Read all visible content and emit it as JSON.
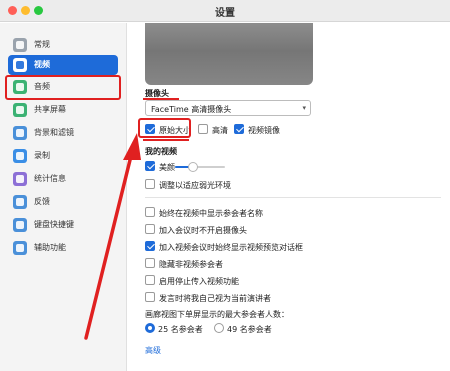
{
  "window": {
    "title": "设置"
  },
  "sidebar": {
    "items": [
      {
        "label": "常规",
        "icon": "gear-icon",
        "active": false
      },
      {
        "label": "视频",
        "icon": "video-camera-icon",
        "active": true
      },
      {
        "label": "音频",
        "icon": "headphones-icon",
        "active": false
      },
      {
        "label": "共享屏幕",
        "icon": "share-screen-icon",
        "active": false
      },
      {
        "label": "背景和滤镜",
        "icon": "background-filter-icon",
        "active": false
      },
      {
        "label": "录制",
        "icon": "record-icon",
        "active": false
      },
      {
        "label": "统计信息",
        "icon": "statistics-icon",
        "active": false
      },
      {
        "label": "反馈",
        "icon": "feedback-icon",
        "active": false
      },
      {
        "label": "键盘快捷键",
        "icon": "keyboard-icon",
        "active": false
      },
      {
        "label": "辅助功能",
        "icon": "accessibility-icon",
        "active": false
      }
    ]
  },
  "camera": {
    "section_label": "摄像头",
    "selected_camera": "FaceTime 高清摄像头",
    "options": [
      {
        "label": "原始大小",
        "checked": true
      },
      {
        "label": "高清",
        "checked": false
      },
      {
        "label": "视频镜像",
        "checked": true
      }
    ]
  },
  "my_video": {
    "section_label": "我的视频",
    "beautify_label": "美颜",
    "beautify_checked": true,
    "beautify_level": 0.35,
    "low_light_label": "调整以适应弱光环境",
    "low_light_checked": false
  },
  "options": [
    {
      "label": "始终在视频中显示参会者名称",
      "checked": false
    },
    {
      "label": "加入会议时不开启摄像头",
      "checked": false
    },
    {
      "label": "加入视频会议时始终显示视频预览对话框",
      "checked": true
    },
    {
      "label": "隐藏非视频参会者",
      "checked": false
    },
    {
      "label": "启用停止传入视频功能",
      "checked": false
    },
    {
      "label": "发言时将我自己视为当前演讲者",
      "checked": false
    }
  ],
  "gallery": {
    "question": "画廊视图下单屏显示的最大参会者人数：",
    "choices": [
      {
        "label": "25 名参会者",
        "selected": true
      },
      {
        "label": "49 名参会者",
        "selected": false
      }
    ]
  },
  "advanced_link": "高级",
  "colors": {
    "accent": "#1e6bd9",
    "annotation": "#e02020"
  }
}
